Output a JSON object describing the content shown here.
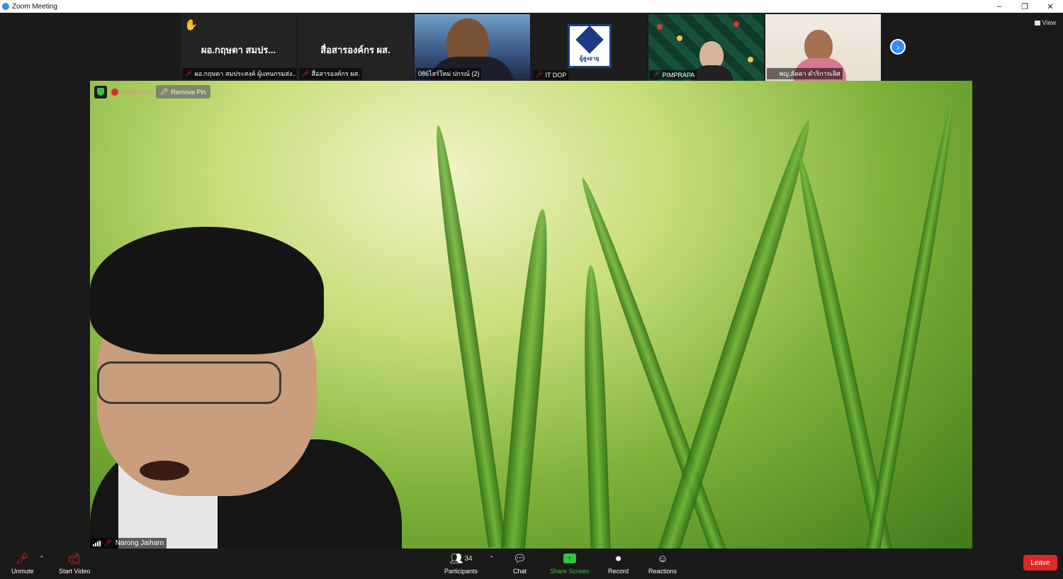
{
  "window": {
    "title": "Zoom Meeting",
    "controls": [
      "–",
      "❐",
      "✕"
    ]
  },
  "gallery": {
    "tiles": [
      {
        "big_name": "ผอ.กฤษดา สมปร...",
        "caption": "ผอ.กฤษดา สมประสงค์ ผู้แทนกรมส่ง..."
      },
      {
        "big_name": "สื่อสารองค์กร ผส.",
        "caption": "สื่อสารองค์กร ผส."
      },
      {
        "big_name": "",
        "caption": "086ไสร์ใหม่ ปกรณ์ (2)"
      },
      {
        "big_name": "",
        "caption": "IT DOP",
        "logo_text": "ผู้สูงอายุ"
      },
      {
        "big_name": "",
        "caption": "PIMPRAPA"
      },
      {
        "big_name": "",
        "caption": "พญ.ลัดดา ดำริการเลิศ"
      }
    ],
    "view_label": "View"
  },
  "stage": {
    "recording_label": "Recording",
    "remove_pin_label": "Remove Pin",
    "speaker_name": "Narong Jaiharn"
  },
  "toolbar": {
    "unmute": "Unmute",
    "start_video": "Start Video",
    "participants": "Participants",
    "participants_count": "34",
    "chat": "Chat",
    "share_screen": "Share Screen",
    "record": "Record",
    "reactions": "Reactions",
    "leave": "Leave"
  },
  "colors": {
    "accent": "#2d8cff",
    "leave": "#e02828",
    "share": "#35c24a",
    "background": "#1a1a1a"
  }
}
